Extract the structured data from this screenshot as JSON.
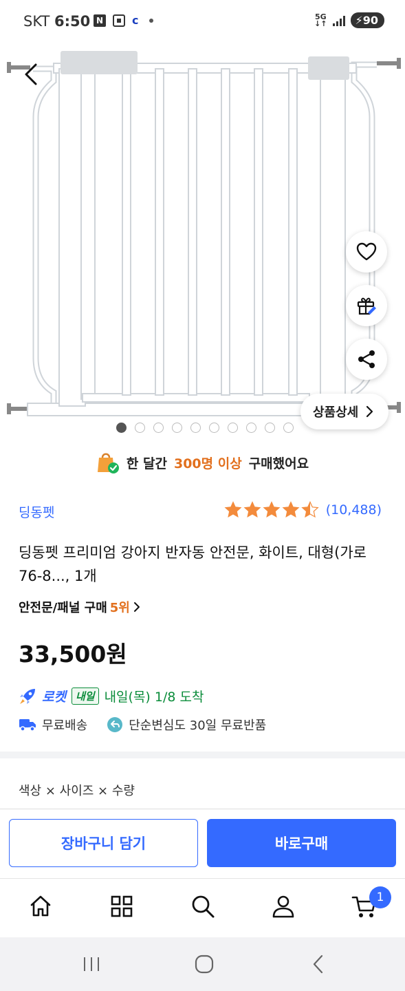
{
  "status_bar": {
    "carrier": "SKT",
    "time": "6:50",
    "network": "5G",
    "battery": "90"
  },
  "image_carousel": {
    "total_images": 10,
    "active_index": 0,
    "detail_button_label": "상품상세"
  },
  "purchase_note": {
    "prefix": "한 달간",
    "highlight": "300명 이상",
    "suffix": "구매했어요"
  },
  "product": {
    "brand": "딩동펫",
    "rating_stars": 4.5,
    "rating_count": "(10,488)",
    "title": "딩동펫 프리미엄 강아지 반자동 안전문, 화이트, 대형(가로 76-8..., 1개",
    "rank_category": "안전문/패널 구매",
    "rank_value": "5위",
    "price": "33,500원"
  },
  "delivery": {
    "rocket_label": "로켓",
    "badge": "내일",
    "arrival": "내일(목) 1/8 도착",
    "free_shipping": "무료배송",
    "free_return": "단순변심도 30일 무료반품"
  },
  "options": {
    "label": "색상 × 사이즈 × 수량"
  },
  "actions": {
    "cart_label": "장바구니 담기",
    "buy_label": "바로구매"
  },
  "bottom_nav": {
    "cart_count": "1"
  },
  "colors": {
    "accent_blue": "#346aff",
    "highlight_orange": "#e2701e",
    "delivery_green": "#0a8c3a",
    "star_orange": "#f38b3c"
  }
}
